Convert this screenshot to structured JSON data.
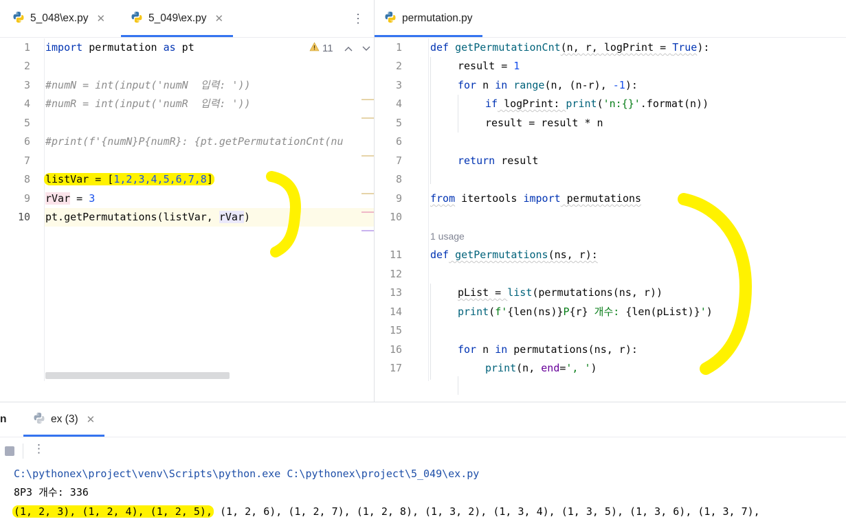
{
  "left_tabs": [
    {
      "label": "5_048\\ex.py",
      "active": false
    },
    {
      "label": "5_049\\ex.py",
      "active": true
    }
  ],
  "left_more_icon": "⋮",
  "inspection": {
    "count": "11"
  },
  "left_lines": [
    {
      "n": "1"
    },
    {
      "n": "2"
    },
    {
      "n": "3"
    },
    {
      "n": "4"
    },
    {
      "n": "5"
    },
    {
      "n": "6"
    },
    {
      "n": "7"
    },
    {
      "n": "8"
    },
    {
      "n": "9"
    },
    {
      "n": "10"
    }
  ],
  "left_code": {
    "l1_kw": "import",
    "l1_mod": " permutation ",
    "l1_as": "as",
    "l1_alias": " pt",
    "l3": "#numN = int(input('numN  입력: '))",
    "l4": "#numR = int(input('numR  입력: '))",
    "l6": "#print(f'{numN}P{numR}: {pt.getPermutationCnt(nu",
    "l8_var": "listVar = [",
    "l8_list": "1,2,3,4,5,6,7,8",
    "l8_end": "]",
    "l9_var": "rVar",
    "l9_eq": " = ",
    "l9_val": "3",
    "l10_a": "pt.getPermutations(listVar, ",
    "l10_b": "rVar",
    "l10_c": ")"
  },
  "right_tab": {
    "label": "permutation.py"
  },
  "right_lines": [
    {
      "n": "1"
    },
    {
      "n": "2"
    },
    {
      "n": "3"
    },
    {
      "n": "4"
    },
    {
      "n": "5"
    },
    {
      "n": "6"
    },
    {
      "n": "7"
    },
    {
      "n": "8"
    },
    {
      "n": "9"
    },
    {
      "n": "10"
    },
    {
      "n": "11"
    },
    {
      "n": "12"
    },
    {
      "n": "13"
    },
    {
      "n": "14"
    },
    {
      "n": "15"
    },
    {
      "n": "16"
    },
    {
      "n": "17"
    }
  ],
  "right_code": {
    "r1_def": "def",
    "r1_fn": " getPermutationCnt",
    "r1_args": "(n, r, logPrint = ",
    "r1_true": "True",
    "r1_end": "):",
    "r2_a": "result = ",
    "r2_num": "1",
    "r3_for": "for",
    "r3_n": " n ",
    "r3_in": "in",
    "r3_range": " range",
    "r3_rest": "(n, (n-r), ",
    "r3_neg": "-1",
    "r3_end": "):",
    "r4_if": "if",
    "r4_lp": " logPrint: ",
    "r4_print": "print",
    "r4_open": "(",
    "r4_str": "'n:{}'",
    "r4_fmt": ".format(n))",
    "r5": "result = result * n",
    "r7_ret": "return",
    "r7_res": " result",
    "r9_from": "from",
    "r9_mod": " itertools ",
    "r9_import": "import",
    "r9_name": " permutations",
    "usage": "1 usage",
    "r11_def": "def",
    "r11_fn": " getPermutations",
    "r11_args": "(ns, r):",
    "r13_a": "pList = ",
    "r13_list": "list",
    "r13_rest": "(permutations(ns, r))",
    "r14_print": "print",
    "r14_open": "(",
    "r14_f": "f'",
    "r14_b1": "{len(ns)}",
    "r14_p": "P",
    "r14_b2": "{r}",
    "r14_txt": " 개수: ",
    "r14_b3": "{len(pList)}",
    "r14_q": "'",
    "r14_close": ")",
    "r16_for": "for",
    "r16_n": " n ",
    "r16_in": "in",
    "r16_rest": " permutations(ns, r):",
    "r17_print": "print",
    "r17_a": "(n, ",
    "r17_end": "end",
    "r17_eq": "=",
    "r17_str": "', '",
    "r17_close": ")"
  },
  "run_panel": {
    "left_label": "n",
    "tab_label": "ex (3)"
  },
  "console": {
    "cmd": "C:\\pythonex\\project\\venv\\Scripts\\python.exe C:\\pythonex\\project\\5_049\\ex.py",
    "count_line": "8P3 개수: 336",
    "hl_part": "(1, 2, 3), (1, 2, 4), (1, 2, 5),",
    "rest_part": " (1, 2, 6), (1, 2, 7), (1, 2, 8), (1, 3, 2), (1, 3, 4), (1, 3, 5), (1, 3, 6), (1, 3, 7),"
  },
  "colors": {
    "accent": "#3574f0",
    "keyword": "#0033b3",
    "highlighter": "#fff200",
    "string": "#067d17",
    "comment": "#8c8c8c",
    "number": "#1750eb",
    "console_cmd": "#1e4fa8"
  }
}
